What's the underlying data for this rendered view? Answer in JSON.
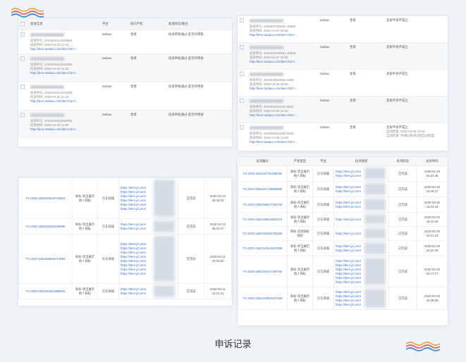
{
  "caption": "申诉记录",
  "p1": {
    "headers": [
      "投诉信息",
      "平台",
      "知识产权",
      "处理状态/备注"
    ],
    "rows": [
      {
        "id": "投诉单号: 2020042313429953",
        "time": "投诉时间: 2020-04-23 11:42",
        "link": "http://item.taobao.com/item.htm?...",
        "platform": "taobao",
        "ip": "金莱",
        "status": "投诉审核通过-是否待审核"
      },
      {
        "id": "投诉单号: 2020042312618495",
        "time": "投诉时间: 2020-04-20 11:28",
        "link": "http://item.taobao.com/item.htm?...",
        "platform": "taobao",
        "ip": "金莱",
        "status": "投诉审核通过-是否待审核"
      },
      {
        "id": "投诉单号: 2020042312315325",
        "time": "投诉时间: 2020-04-20 11:24",
        "link": "http://item.taobao.com/item.htm?...",
        "platform": "taobao",
        "ip": "金莱",
        "status": "投诉审核通过-是否待审核"
      },
      {
        "id": "投诉单号: 2020042310930269",
        "time": "投诉时间: 2020-04-20 11:00",
        "link": "http://item.taobao.com/item.htm?...",
        "platform": "taobao",
        "ip": "金莱",
        "status": "投诉审核通过-是否待审核"
      }
    ]
  },
  "p2": {
    "rows": [
      {
        "id": "投诉单号: 2020040709391.46599",
        "time": "投诉时间: 2020-04-07 09:36",
        "link": "http://item.taobao.com/item.htm?...",
        "platform": "taobao",
        "ip": "金莱",
        "status": "卖家申诉不成立"
      },
      {
        "id": "投诉单号: 2020040709391.46599",
        "time": "投诉时间: 2020-04-07 09:36",
        "link": "http://item.taobao.com/item.htm?...",
        "platform": "taobao",
        "ip": "金莱",
        "status": "卖家申诉不成立"
      },
      {
        "id": "投诉单号: 2020040622553.2269",
        "time": "投诉时间: 2020-04-06 23:55",
        "link": "http://item.taobao.com/item.htm?...",
        "platform": "taobao",
        "ip": "金莱",
        "status": "卖家申诉不成立"
      },
      {
        "id": "投诉单号: 2020040615434.8822",
        "time": "投诉时间: 2020-04-06 15:42",
        "link": "http://item.taobao.com/item.htm?...",
        "platform": "taobao",
        "ip": "金莱",
        "status": "卖家申诉不成立"
      },
      {
        "id": "投诉单号: 2020040615485.6045",
        "time": "投诉时间: 2020-04-05 13:48",
        "link": "http://item.taobao.com/item.htm?...",
        "platform": "taobao",
        "ip": "金莱",
        "status": "卖家申诉不成立",
        "note1": "自动结案: 2020-04-06 19:42",
        "note2": "自动结束: 申请已关闭已经自动结案"
      }
    ]
  },
  "p3": {
    "rows": [
      {
        "id": "TS-2020-1582332549729533",
        "type": "商标-突出展示他人商标",
        "platform": "京东商城",
        "urls": [
          "https://item.jd.com/",
          "https://item.jd.com/",
          "https://item.jd.com/",
          "https://item.jd.com/",
          "https://item.jd.com/",
          "https://item.jd.com/"
        ],
        "status": "已完成",
        "date": "2020-02-22",
        "time": "08:49:16"
      },
      {
        "id": "TS-2020-1582331880165896",
        "type": "商标-突出展示他人商标",
        "platform": "京东商城",
        "urls": [
          "https://item.jd.com/",
          "https://item.jd.com/"
        ],
        "status": "已完成",
        "date": "2020-02-22",
        "time": "08:41:27"
      },
      {
        "id": "TS-2020-1582259655713953",
        "type": "商标-突出展示他人商标",
        "platform": "京东商城",
        "urls": [
          "https://item.jd.com/",
          "https://item.jd.com/",
          "https://item.jd.com/",
          "https://item.jd.com/",
          "https://item.jd.com/",
          "https://item.jd.com/",
          "https://item.jd.com/",
          "https://item.jd.com/"
        ],
        "status": "已完成",
        "date": "2020-02-21",
        "time": "15:23:52"
      },
      {
        "id": "TS-2020-1582264854988834",
        "type": "商标-突出展示他人商标",
        "platform": "京东商城",
        "urls": [
          "https://item.jd.com/",
          "https://item.jd.com/"
        ],
        "status": "已完成",
        "date": "2020-02-21",
        "time": "14:12:41"
      }
    ]
  },
  "p4": {
    "headers": [
      "投诉编号",
      "产权类型",
      "平台",
      "投诉链接",
      "处理状态",
      "投诉时间"
    ],
    "rows": [
      {
        "id": "TS-2020-1582167751198784",
        "type": "商标-突出展示他人商标",
        "platform": "京东商城",
        "urls": [
          "https://item.jd.com/",
          "https://item.jd.com/"
        ],
        "status": "已完成",
        "date": "2020-02-20",
        "time": "16:37:45"
      },
      {
        "id": "TS-2020-1582167135888966",
        "type": "商标-突出展示他人商标",
        "platform": "京东商城",
        "urls": [
          "https://item.jd.com/",
          "https://item.jd.com/"
        ],
        "status": "已完成",
        "date": "2020-02-20",
        "time": "16:28:47"
      },
      {
        "id": "TS-2020-1582166627164753",
        "type": "商标-突出展示他人商标",
        "platform": "京东商城",
        "urls": [
          "https://item.jd.com/",
          "https://item.jd.com/"
        ],
        "status": "已完成",
        "date": "2020-02-20",
        "time": "16:24:44"
      },
      {
        "id": "TS-2020-1582168023843474",
        "type": "商标-突出展示他人商标",
        "platform": "京东商城",
        "urls": [
          "https://item.jd.com/"
        ],
        "status": "已完成",
        "date": "2020-02-20",
        "time": "16:11:48"
      },
      {
        "id": "TS-2020-1582165452766168",
        "type": "商标-其他商标侵权",
        "platform": "京东商城",
        "urls": [
          "https://item.jd.com/"
        ],
        "status": "已完成",
        "date": "2020-02-20",
        "time": "16:01:24"
      },
      {
        "id": "TS-2020-1582164941841598",
        "type": "商标-突出展示他人商标",
        "platform": "京东商城",
        "urls": [
          "https://item.jd.com/",
          "https://item.jd.com/"
        ],
        "status": "已完成",
        "date": "2020-02-20",
        "time": "15:52:28"
      },
      {
        "id": "TS-2020-1582164447184764",
        "type": "商标-突出展示他人商标",
        "platform": "京东商城",
        "urls": [
          "https://item.jd.com/",
          "https://item.jd.com/",
          "https://item.jd.com/",
          "https://item.jd.com/",
          "https://item.jd.com/",
          "https://item.jd.com/"
        ],
        "status": "已完成",
        "date": "2020-02-20",
        "time": "15:47:17"
      },
      {
        "id": "TS-2020-1582163824327169",
        "type": "商标-突出展示他人商标",
        "platform": "京东商城",
        "urls": [
          "https://item.jd.com/",
          "https://item.jd.com/",
          "https://item.jd.com/",
          "https://item.jd.com/"
        ],
        "status": "已完成",
        "date": "2020-02-20",
        "time": "15:38:06"
      }
    ]
  }
}
